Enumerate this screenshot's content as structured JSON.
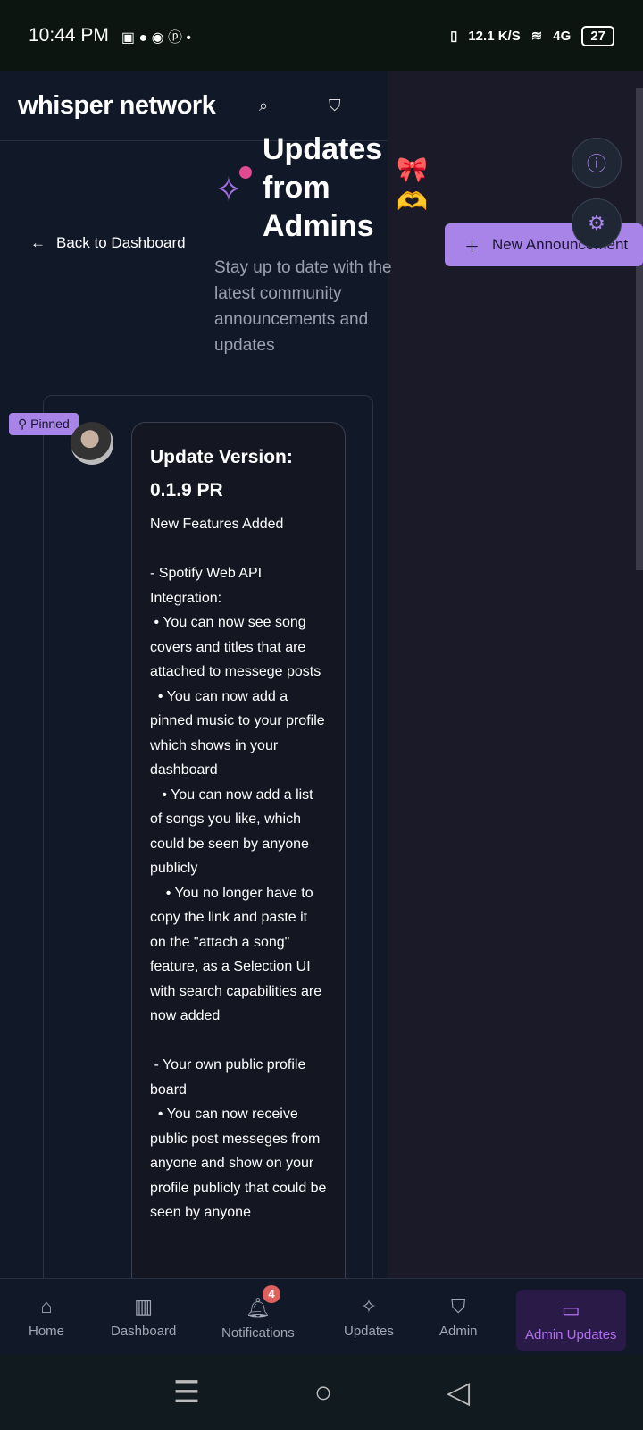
{
  "status": {
    "time": "10:44 PM",
    "speed": "12.1 K/S",
    "network": "4G",
    "battery": "27"
  },
  "header": {
    "logo": "whisper network"
  },
  "page": {
    "back": "Back to Dashboard",
    "title_lines": [
      "Updates",
      "from",
      "Admins"
    ],
    "subtitle": "Stay up to date with the latest community announcements and updates",
    "new_button": "New Announcement"
  },
  "post": {
    "pinned": "Pinned",
    "title": "Update Version: 0.1.9 PR",
    "body": "New Features Added\n\n- Spotify Web API Integration:\n • You can now see song covers and titles that are attached to messege posts\n  • You can now add a pinned music to your profile which shows in your dashboard\n   • You can now add a list of songs you like, which could be seen by anyone publicly\n    • You no longer have to copy the link and paste it on the \"attach a song\" feature, as a Selection UI with search capabilities are now added\n\n - Your own public profile board\n  • You can now receive public post messeges from anyone and show on your profile publicly that could be seen by anyone"
  },
  "nav": {
    "items": [
      "Home",
      "Dashboard",
      "Notifications",
      "Updates",
      "Admin",
      "Admin Updates"
    ],
    "badge": "4"
  }
}
